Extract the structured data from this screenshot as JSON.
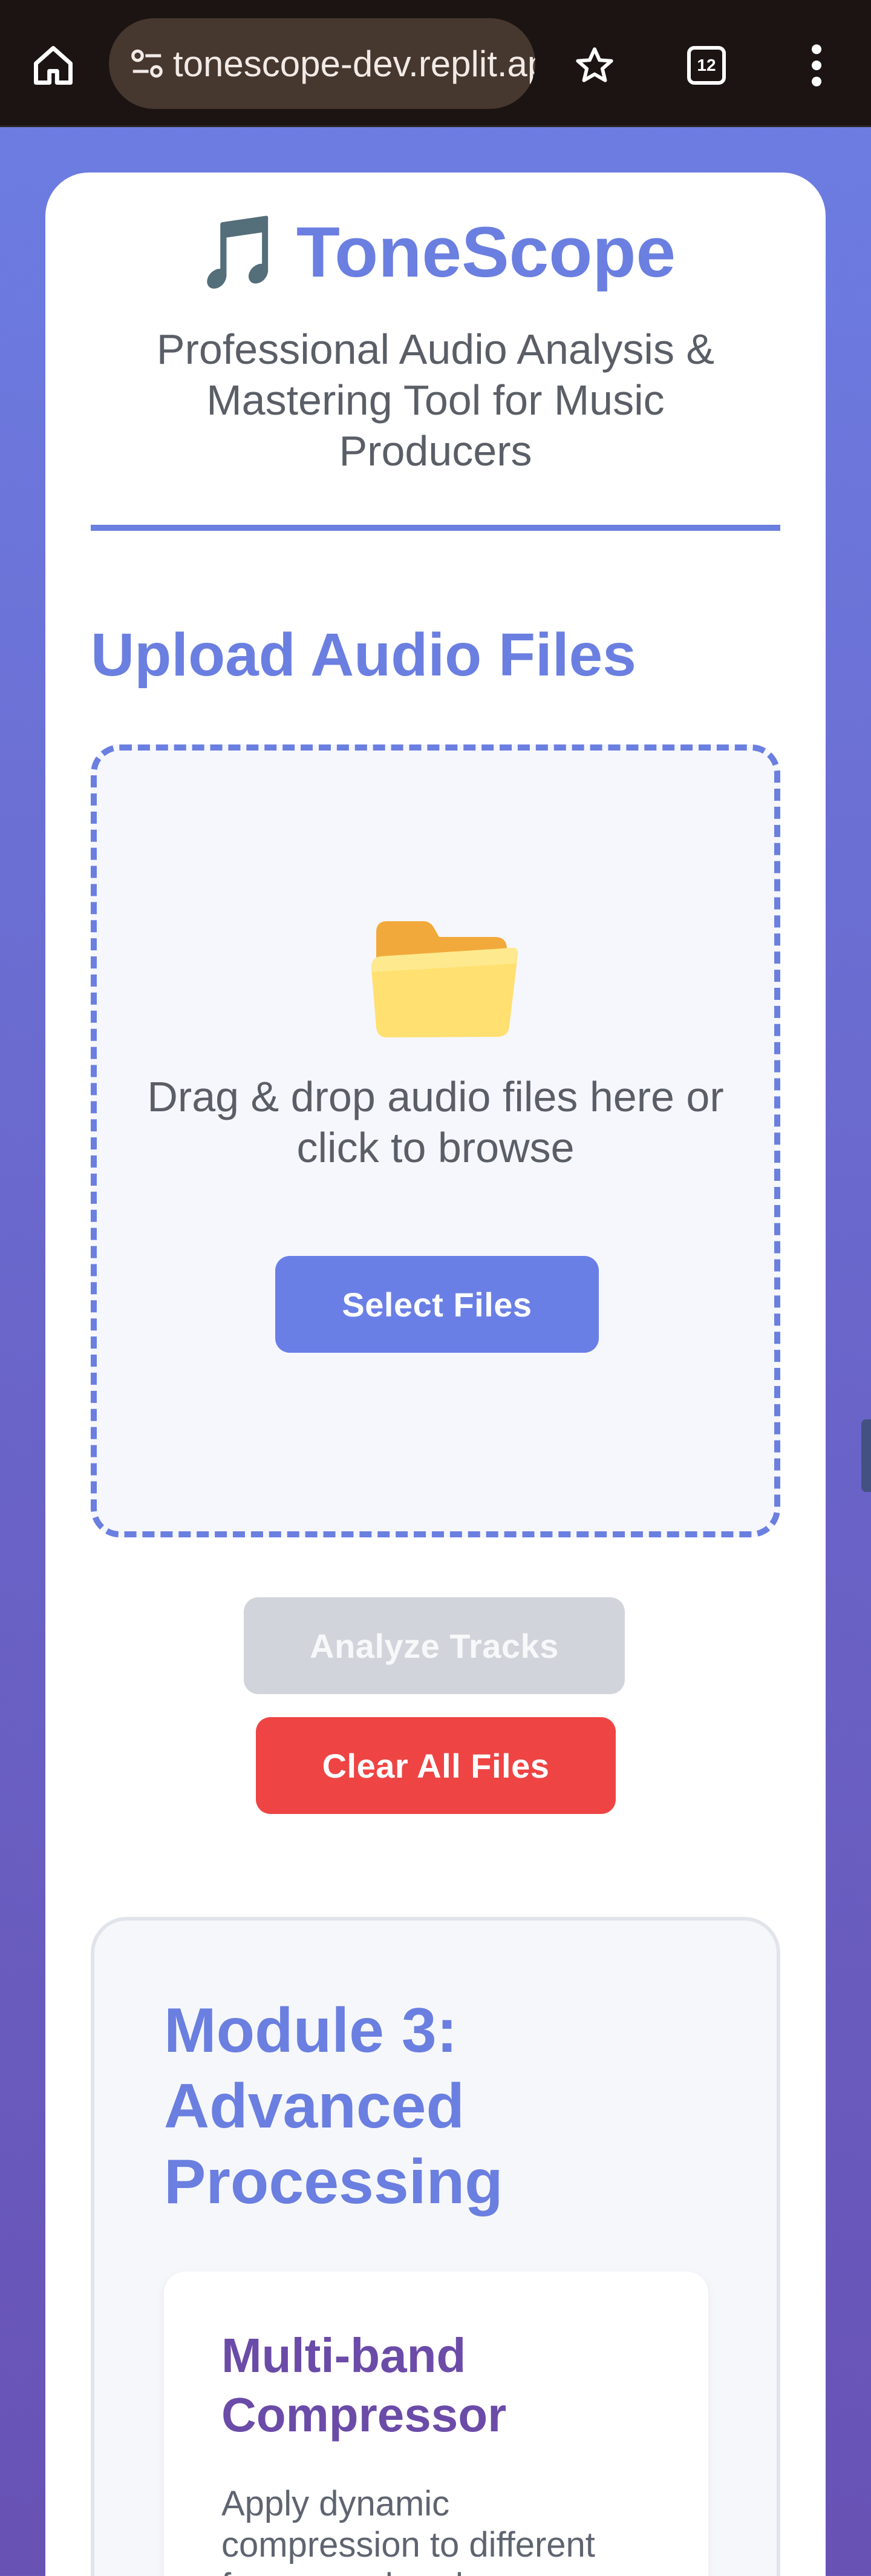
{
  "browser": {
    "url": "tonescope-dev.replit.app",
    "tab_count": "12"
  },
  "header": {
    "title": "ToneScope",
    "title_emoji": "🎵",
    "subtitle": "Professional Audio Analysis & Mastering Tool for Music Producers"
  },
  "upload": {
    "section_title": "Upload Audio Files",
    "drop_text": "Drag & drop audio files here or click to browse",
    "select_label": "Select Files"
  },
  "actions": {
    "analyze_label": "Analyze Tracks",
    "clear_label": "Clear All Files"
  },
  "module": {
    "title": "Module 3: Advanced Processing",
    "tool": {
      "title": "Multi-band Compressor",
      "description": "Apply dynamic compression to different frequency bands"
    }
  },
  "colors": {
    "accent": "#6a7fe0",
    "danger": "#ef4444",
    "disabled": "#d1d4da",
    "module_heading": "#6b4ba8"
  },
  "icons": {
    "home": "home-icon",
    "site_settings": "tune-icon",
    "bookmark": "star-icon",
    "tabs": "tab-switcher-icon",
    "menu": "more-vert-icon",
    "folder": "folder-icon",
    "music": "music-note-icon"
  }
}
